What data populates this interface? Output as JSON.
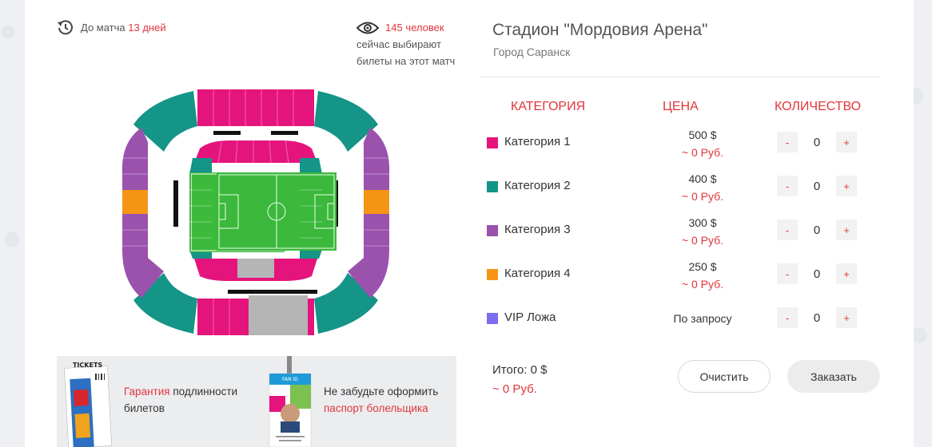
{
  "countdown": {
    "prefix": "До матча",
    "value": "13 дней"
  },
  "viewers": {
    "count": "145 человек",
    "line2": "сейчас выбирают",
    "line3": "билеты на этот матч"
  },
  "venue": {
    "title": "Стадион \"Мордовия Арена\"",
    "city": "Город Саранск"
  },
  "table": {
    "headers": {
      "category": "КАТЕГОРИЯ",
      "price": "ЦЕНА",
      "quantity": "КОЛИЧЕСТВО"
    },
    "rows": [
      {
        "name": "Категория 1",
        "color": "#e5147d",
        "price": "500 $",
        "rub": "~ 0 Руб.",
        "qty": "0",
        "minus": "-",
        "plus": "+"
      },
      {
        "name": "Категория 2",
        "color": "#159488",
        "price": "400 $",
        "rub": "~ 0 Руб.",
        "qty": "0",
        "minus": "-",
        "plus": "+"
      },
      {
        "name": "Категория 3",
        "color": "#9b52ad",
        "price": "300 $",
        "rub": "~ 0 Руб.",
        "qty": "0",
        "minus": "-",
        "plus": "+"
      },
      {
        "name": "Категория 4",
        "color": "#f59516",
        "price": "250 $",
        "rub": "~ 0 Руб.",
        "qty": "0",
        "minus": "-",
        "plus": "+"
      },
      {
        "name": "VIP Ложа",
        "color": "#7b6cf0",
        "price": "По запросу",
        "rub": "",
        "qty": "0",
        "minus": "-",
        "plus": "+"
      }
    ]
  },
  "total": {
    "label": "Итого: 0 $",
    "rub": "~ 0 Руб."
  },
  "buttons": {
    "clear": "Очистить",
    "order": "Заказать"
  },
  "promo": {
    "ticket_label": "TICKETS",
    "guarantee_highlight": "Гарантия",
    "guarantee_rest": "подлинности",
    "guarantee_line2": "билетов",
    "passport_line1": "Не забудьте оформить",
    "passport_highlight": "паспорт болельщика",
    "fan_id_label": "FAN ID"
  },
  "icons": {
    "countdown": "timer-icon",
    "viewers": "eye-icon"
  }
}
